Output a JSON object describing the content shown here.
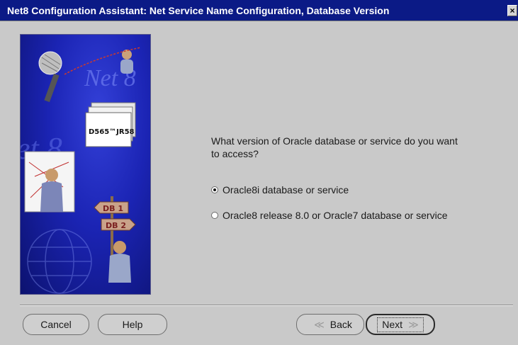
{
  "window": {
    "title": "Net8 Configuration Assistant: Net Service Name Configuration, Database Version",
    "close_glyph": "×"
  },
  "banner": {
    "logo_text": "Net 8",
    "folder_label": "D565™JR58",
    "sign_labels": [
      "DB 1",
      "DB 2"
    ]
  },
  "question": {
    "text": "What version of Oracle database or service do you want to access?"
  },
  "options": [
    {
      "label": "Oracle8i database or service",
      "selected": true
    },
    {
      "label": "Oracle8 release 8.0 or Oracle7 database or service",
      "selected": false
    }
  ],
  "buttons": {
    "cancel": "Cancel",
    "help": "Help",
    "back": "Back",
    "next": "Next",
    "back_glyph": "≪",
    "next_glyph": "≫"
  }
}
